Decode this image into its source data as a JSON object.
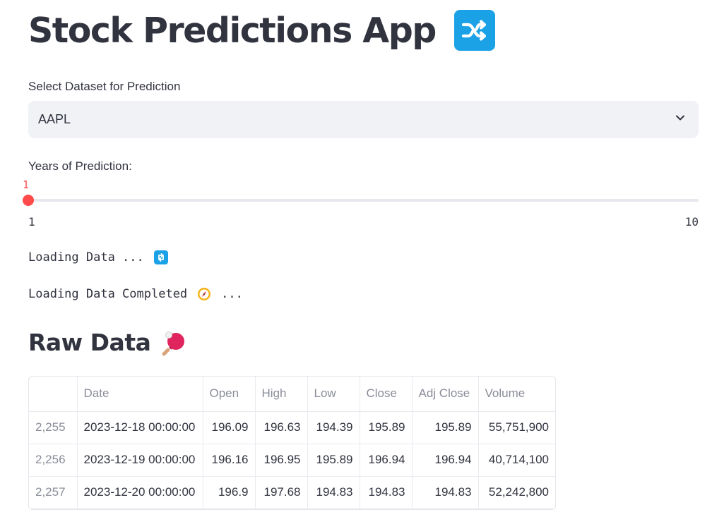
{
  "app": {
    "title": "Stock Predictions App",
    "title_icon": "twisted-arrows-shuffle-icon"
  },
  "dataset_select": {
    "label": "Select Dataset for Prediction",
    "selected": "AAPL",
    "icon": "chevron-down-icon"
  },
  "years_slider": {
    "label": "Years of Prediction:",
    "value": 1,
    "value_label": "1",
    "min_label": "1",
    "max_label": "10",
    "accent_color": "#ff4b4b"
  },
  "status": {
    "loading_text": "Loading Data ...",
    "loading_icon": "refresh-icon",
    "completed_text": "Loading Data Completed",
    "completed_icon": "compass-icon",
    "completed_suffix": "..."
  },
  "raw_data": {
    "heading": "Raw Data",
    "heading_icon": "ping-pong-paddle-icon",
    "columns": [
      "",
      "Date",
      "Open",
      "High",
      "Low",
      "Close",
      "Adj Close",
      "Volume"
    ],
    "rows": [
      [
        "2,255",
        "2023-12-18 00:00:00",
        "196.09",
        "196.63",
        "194.39",
        "195.89",
        "195.89",
        "55,751,900"
      ],
      [
        "2,256",
        "2023-12-19 00:00:00",
        "196.16",
        "196.95",
        "195.89",
        "196.94",
        "196.94",
        "40,714,100"
      ],
      [
        "2,257",
        "2023-12-20 00:00:00",
        "196.9",
        "197.68",
        "194.83",
        "194.83",
        "194.83",
        "52,242,800"
      ]
    ]
  }
}
